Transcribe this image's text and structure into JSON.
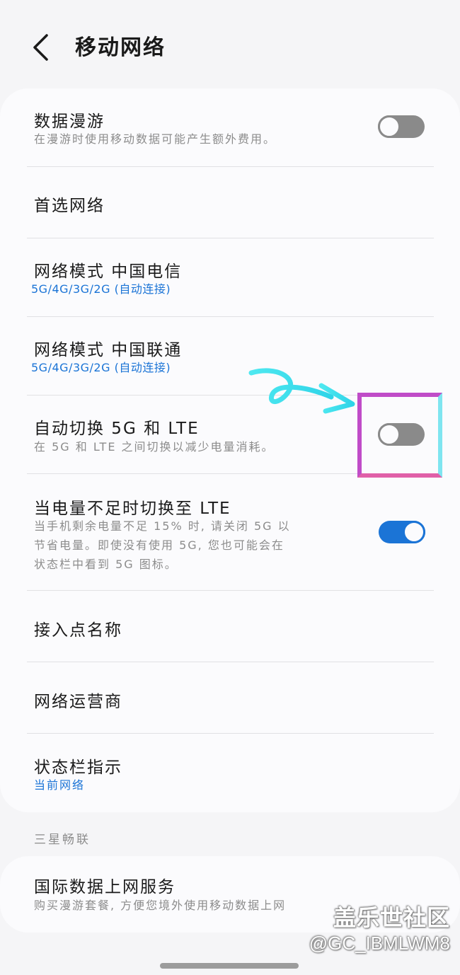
{
  "header": {
    "title": "移动网络"
  },
  "rows": [
    {
      "title": "数据漫游",
      "sub": "在漫游时使用移动数据可能产生额外费用。",
      "toggle": "off"
    },
    {
      "title": "首选网络"
    },
    {
      "title": "网络模式 中国电信",
      "sub": "5G/4G/3G/2G (自动连接)"
    },
    {
      "title": "网络模式 中国联通",
      "sub": "5G/4G/3G/2G (自动连接)"
    },
    {
      "title": "自动切换 5G 和 LTE",
      "sub": "在 5G 和 LTE 之间切换以减少电量消耗。",
      "toggle": "off"
    },
    {
      "title": "当电量不足时切换至 LTE",
      "sub_lines": [
        "当手机剩余电量不足 15% 时, 请关闭 5G 以",
        "节省电量。即使没有使用 5G, 您也可能会在",
        "状态栏中看到 5G 图标。"
      ],
      "toggle": "on"
    },
    {
      "title": "接入点名称"
    },
    {
      "title": "网络运营商"
    },
    {
      "title": "状态栏指示",
      "sub": "当前网络"
    }
  ],
  "section": {
    "label": "三星畅联"
  },
  "world_row": {
    "title": "国际数据上网服务",
    "sub": "购买漫游套餐, 方便您境外使用移动数据上网"
  },
  "watermark": {
    "line1": "盖乐世社区",
    "line2": "@GC_IBMLWM8"
  },
  "colors": {
    "accent": "#1b74d6",
    "toggle_off": "#8a8a8a",
    "background": "#f5f5f7",
    "card": "#fbfbfd"
  }
}
